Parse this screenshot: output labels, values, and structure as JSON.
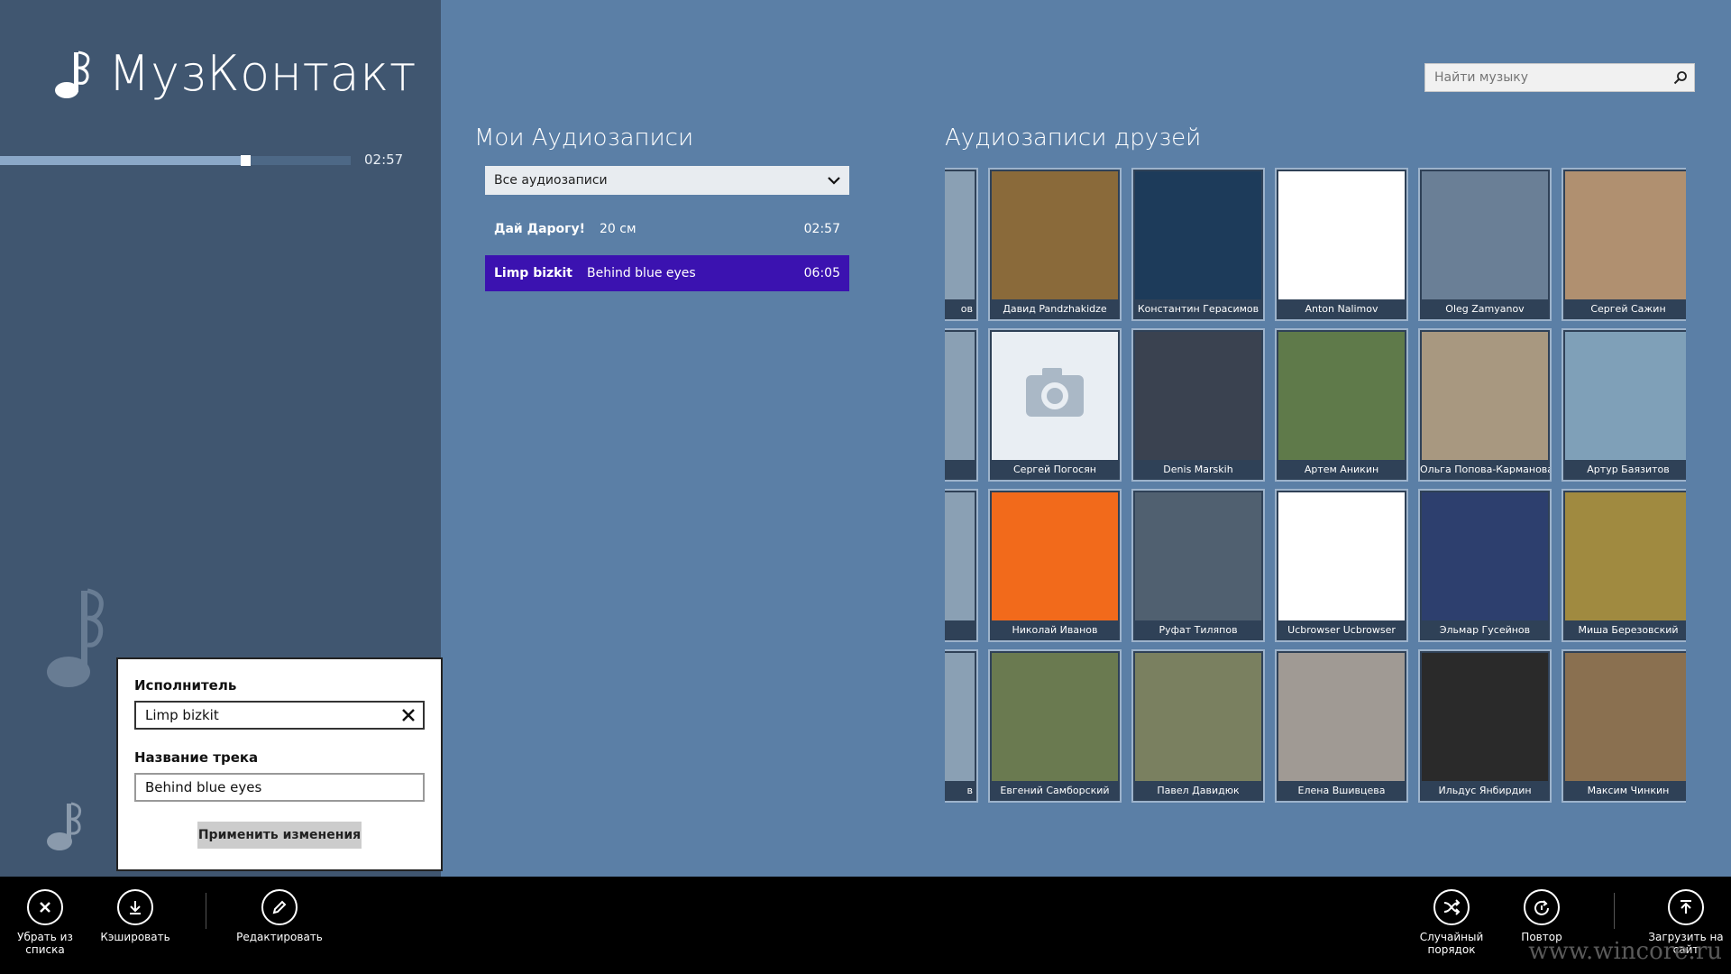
{
  "app": {
    "title": "МузКонтакт"
  },
  "player": {
    "time": "02:57",
    "progress": 0.7
  },
  "search": {
    "placeholder": "Найти музыку"
  },
  "my_audio": {
    "title": "Мои Аудиозаписи",
    "filter": "Все аудиозаписи",
    "tracks": [
      {
        "artist": "Дай Дарогу!",
        "title": "20 см",
        "duration": "02:57",
        "selected": false
      },
      {
        "artist": "Limp bizkit",
        "title": "Behind blue eyes",
        "duration": "06:05",
        "selected": true
      }
    ]
  },
  "friends": {
    "title": "Аудиозаписи друзей",
    "partial_labels": [
      "ов",
      "",
      "",
      "в"
    ],
    "items": [
      {
        "name": "Давид Pandzhakidze",
        "color": "#8a6a3a"
      },
      {
        "name": "Константин Герасимов",
        "color": "#1d3b5a"
      },
      {
        "name": "Anton Nalimov",
        "color": "#ffffff"
      },
      {
        "name": "Oleg Zamyanov",
        "color": "#6a7f96"
      },
      {
        "name": "Сергей Сажин",
        "color": "#b09070"
      },
      {
        "name": "Сергей Погосян",
        "color": "#e9eef3"
      },
      {
        "name": "Denis Marskih",
        "color": "#3a4250"
      },
      {
        "name": "Артем Аникин",
        "color": "#5f7a4a"
      },
      {
        "name": "Ольга Попова-Карманова",
        "color": "#a89880"
      },
      {
        "name": "Артур Баязитов",
        "color": "#7fa0b8"
      },
      {
        "name": "Николай Иванов",
        "color": "#f26a1b"
      },
      {
        "name": "Руфат Тиляпов",
        "color": "#506070"
      },
      {
        "name": "Ucbrowser Ucbrowser",
        "color": "#ffffff"
      },
      {
        "name": "Эльмар Гусейнов",
        "color": "#2d3f6e"
      },
      {
        "name": "Миша Березовский",
        "color": "#a08a40"
      },
      {
        "name": "Евгений Самборский",
        "color": "#6a7a50"
      },
      {
        "name": "Павел Давидюк",
        "color": "#7a8060"
      },
      {
        "name": "Елена Вшивцева",
        "color": "#a09a94"
      },
      {
        "name": "Ильдус Янбирдин",
        "color": "#2a2a2a"
      },
      {
        "name": "Максим Чинкин",
        "color": "#8a7050"
      }
    ]
  },
  "edit_panel": {
    "artist_label": "Исполнитель",
    "artist_value": "Limp bizkit",
    "track_label": "Название трека",
    "track_value": "Behind blue eyes",
    "apply_label": "Применить изменения"
  },
  "appbar": {
    "remove": "Убрать из списка",
    "cache": "Кэшировать",
    "edit": "Редактировать",
    "shuffle": "Случайный порядок",
    "repeat": "Повтор",
    "upload": "Загрузить на сайт"
  },
  "watermark": "www.wincore.ru"
}
